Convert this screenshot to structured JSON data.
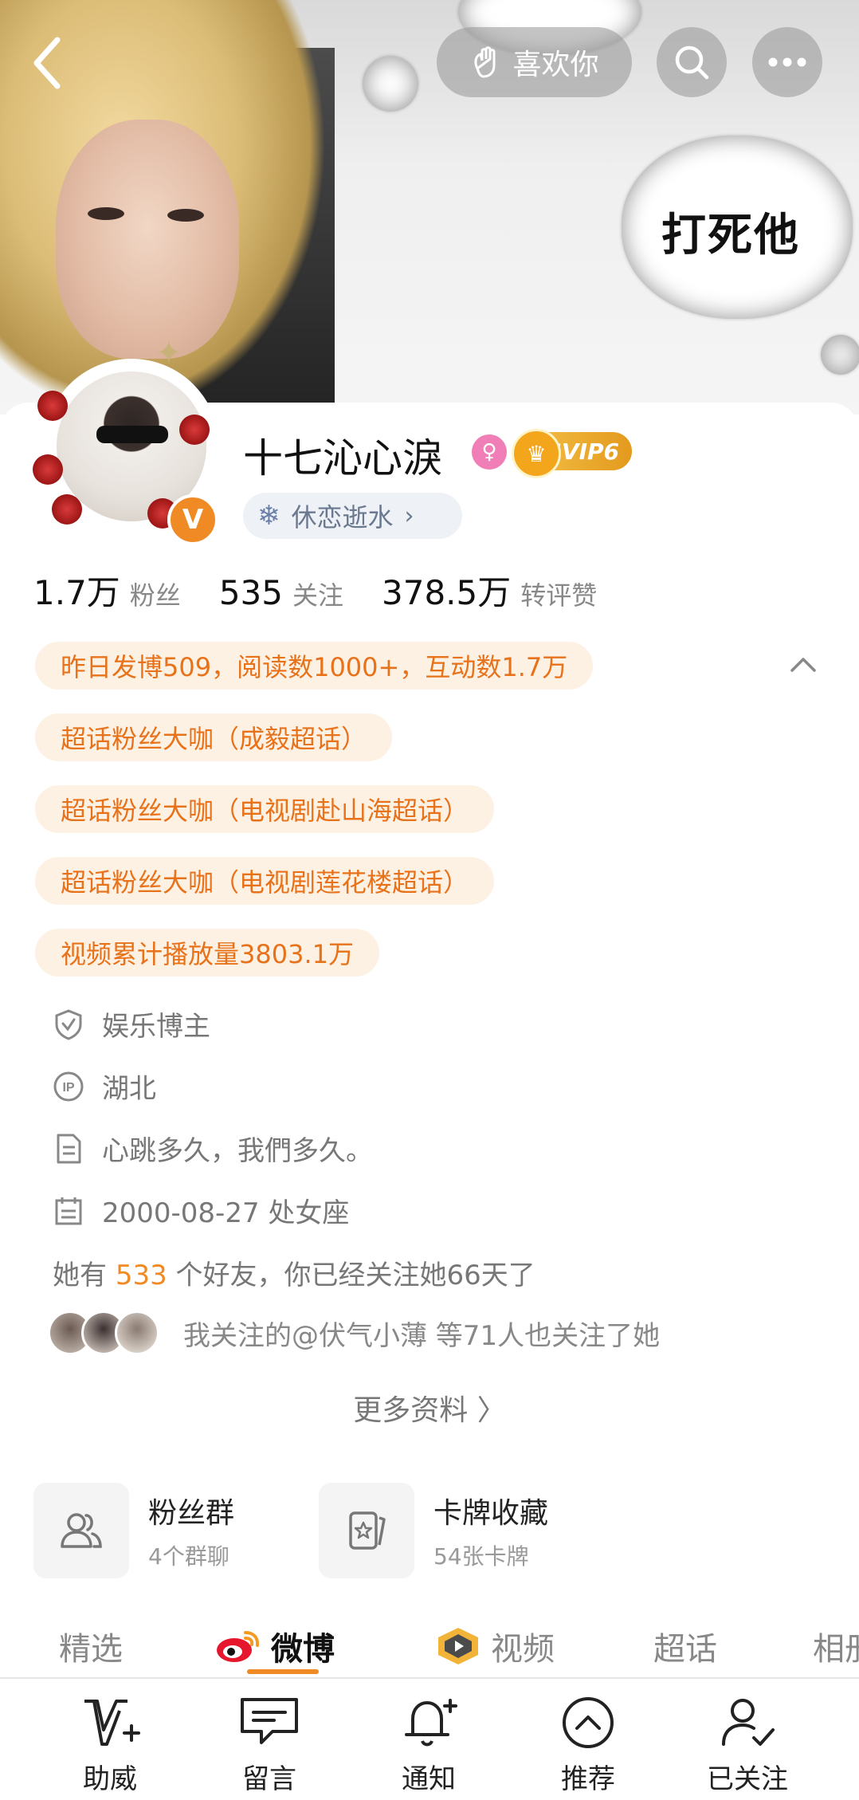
{
  "header": {
    "like_label": "喜欢你",
    "bubble_text": "打死他"
  },
  "profile": {
    "username": "十七沁心淚",
    "gender_symbol": "♀",
    "svip_label": "SVIP6",
    "tag_label": "休恋逝水",
    "stats": [
      {
        "value": "1.7万",
        "label": "粉丝"
      },
      {
        "value": "535",
        "label": "关注"
      },
      {
        "value": "378.5万",
        "label": "转评赞"
      }
    ],
    "highlights": [
      "昨日发博509，阅读数1000+，互动数1.7万",
      "超话粉丝大咖（成毅超话）",
      "超话粉丝大咖（电视剧赴山海超话）",
      "超话粉丝大咖（电视剧莲花楼超话）",
      "视频累计播放量3803.1万"
    ],
    "info": {
      "category": "娱乐博主",
      "ip_location": "湖北",
      "bio": "心跳多久，我們多久。",
      "birthday": "2000-08-27 处女座"
    },
    "friends": {
      "prefix": "她有",
      "count": "533",
      "suffix": "个好友，你已经关注她66天了"
    },
    "mutual_follow": "我关注的@伏气小薄 等71人也关注了她",
    "more_label": "更多资料 〉"
  },
  "cards": [
    {
      "title": "粉丝群",
      "subtitle": "4个群聊"
    },
    {
      "title": "卡牌收藏",
      "subtitle": "54张卡牌"
    }
  ],
  "tabs": [
    "精选",
    "微博",
    "视频",
    "超话",
    "相册"
  ],
  "bottom_nav": [
    "助威",
    "留言",
    "通知",
    "推荐",
    "已关注"
  ],
  "colors": {
    "accent": "#f08a24",
    "highlight_bg": "#fdf1e4",
    "highlight_text": "#e8721a"
  }
}
